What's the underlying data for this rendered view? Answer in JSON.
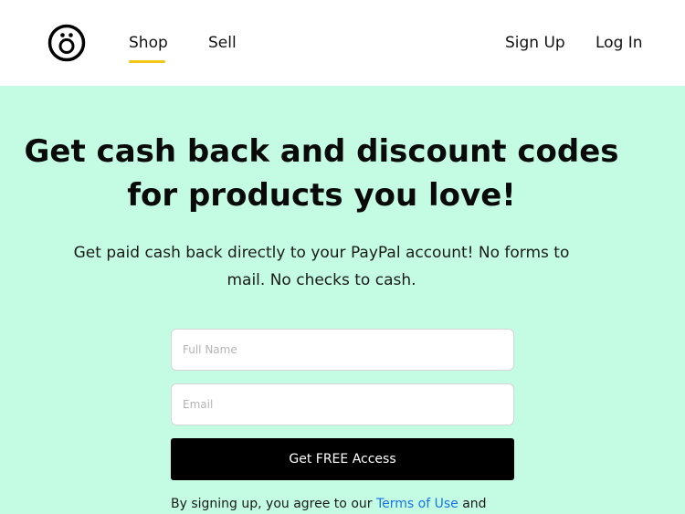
{
  "nav": {
    "logo": "brand-logo",
    "links": {
      "shop": "Shop",
      "sell": "Sell",
      "signup": "Sign Up",
      "login": "Log In"
    },
    "active_underline_color": "#f5c518"
  },
  "hero": {
    "background": "#c3fce2",
    "headline_line1": "Get cash back and discount codes",
    "headline_line2": "for products you love!",
    "subtext_line1": "Get paid cash back directly to your PayPal account! No forms to",
    "subtext_line2": "mail. No checks to cash.",
    "form": {
      "name_placeholder": "Full Name",
      "email_placeholder": "Email",
      "submit_label": "Get FREE Access"
    },
    "legal": {
      "prefix": "By signing up, you agree to our ",
      "terms_link": "Terms of Use",
      "suffix": " and"
    }
  }
}
